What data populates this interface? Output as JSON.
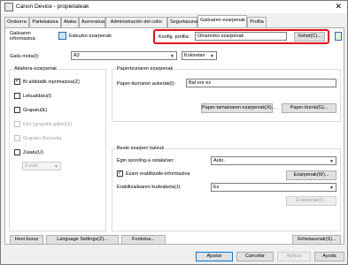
{
  "window": {
    "title": "Canon Device - propietateak"
  },
  "tabs": [
    {
      "label": "Orokorra"
    },
    {
      "label": "Partekatzea"
    },
    {
      "label": "Ataka"
    },
    {
      "label": "Aurreratua"
    },
    {
      "label": "Administración del color"
    },
    {
      "label": "Segurtasuna"
    },
    {
      "label": "Gailuaren ezarpenak"
    },
    {
      "label": "Profila"
    }
  ],
  "top": {
    "device_info_label": "Gailuaren informazioa:",
    "easy_settings_label": "Eskuzko ezarpenak",
    "config_profile_label": "Konfig. profila:",
    "config_profile_value": "Oinarrizko ezarpenak",
    "details_button": "Xehet(C)...",
    "device_model_label": "Gailu mota(I):",
    "paper_select": "A3",
    "color_select": "Koloretan",
    "highlight_color": "#e0101a"
  },
  "output_options": {
    "legend": "Akabera-ezarpenak",
    "items": [
      {
        "label": "Bi aldetatik inprimatzea(Z)",
        "checked": true,
        "enabled": true
      },
      {
        "label": "Lekualdatu(I)",
        "checked": false,
        "enabled": true
      },
      {
        "label": "Grapatu(E)",
        "checked": false,
        "enabled": true
      },
      {
        "label": "Eko (grapatik gabe)(X)",
        "checked": false,
        "enabled": false
      },
      {
        "label": "Grapatu liburuxka",
        "checked": false,
        "enabled": false
      },
      {
        "label": "Zulatu(U)",
        "checked": false,
        "enabled": true
      }
    ],
    "punch_select": "2 zulo"
  },
  "paper_settings": {
    "legend": "Papertzuriaren ezarpenak",
    "source_label": "Paper-iturriaren aukerak(I):",
    "source_value": "Bat ere ez",
    "tray_button": "Paper-tamainaren ezarpenak(X)...",
    "source_button": "Paper-iturria(G)..."
  },
  "misc_settings": {
    "legend": "Beste ezarpen batzuk",
    "spool_label": "Egin spooling-a ostalarian:",
    "spool_value": "Auto.",
    "info_checkbox": "Ezarri erabiltzaile-informazioa",
    "info_checked": true,
    "settings_button": "Ezarpenak(W)...",
    "auth_label": "Erabiltzailearen kudeaketa(J):",
    "auth_value": "Ez",
    "auth_settings_button": "Ezarpenak(I)..."
  },
  "bottom": {
    "btn1": "Honi buruz",
    "btn2": "Language Settings(Z)...",
    "btn3": "Funtzioa...",
    "btn4": "Xehetasunak(S)..."
  },
  "dialog": {
    "ok": "Ajustar",
    "cancel": "Cancelar",
    "apply": "Aplicar",
    "help": "Ayuda"
  }
}
